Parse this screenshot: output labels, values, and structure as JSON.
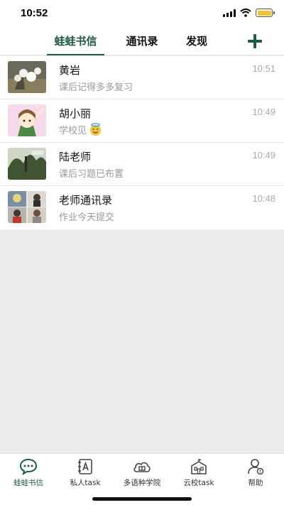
{
  "status_bar": {
    "time": "10:52"
  },
  "top_nav": {
    "tabs": [
      {
        "label": "蛙蛙书信",
        "active": true
      },
      {
        "label": "通讯录",
        "active": false
      },
      {
        "label": "发现",
        "active": false
      }
    ],
    "add_icon": "plus-icon"
  },
  "chats": [
    {
      "name": "黄岩",
      "preview": "课后记得多多复习",
      "time": "10:51"
    },
    {
      "name": "胡小丽",
      "preview": "学校见",
      "time": "10:49",
      "emoji": "smiling-face-with-halo"
    },
    {
      "name": "陆老师",
      "preview": "课后习题已布置",
      "time": "10:49"
    },
    {
      "name": "老师通讯录",
      "preview": "作业今天提交",
      "time": "10:48"
    }
  ],
  "bottom_nav": {
    "items": [
      {
        "label": "蛙蛙书信",
        "icon": "chat-bubble-icon",
        "active": true
      },
      {
        "label": "私人task",
        "icon": "notebook-icon",
        "active": false
      },
      {
        "label": "多语种学院",
        "icon": "cloud-school-icon",
        "active": false
      },
      {
        "label": "云校task",
        "icon": "school-building-icon",
        "active": false
      },
      {
        "label": "帮助",
        "icon": "help-user-icon",
        "active": false
      }
    ]
  },
  "colors": {
    "accent": "#1f5a45",
    "background": "#ececec"
  }
}
